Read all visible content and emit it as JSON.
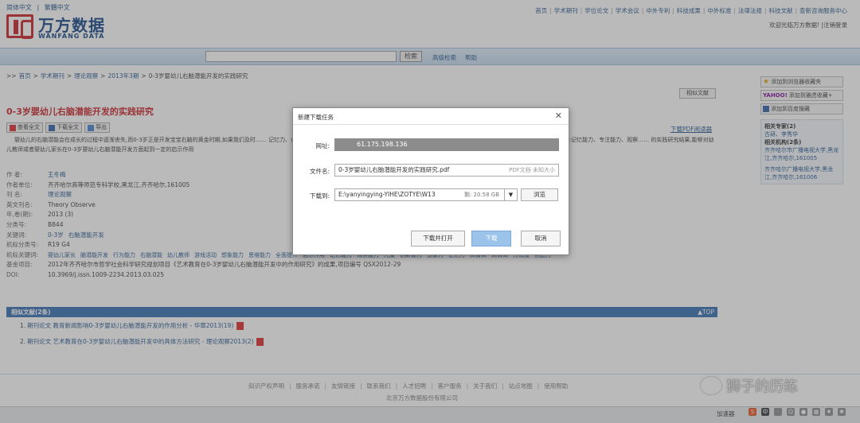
{
  "lang": {
    "simplified": "简体中文",
    "sep": "|",
    "traditional": "繁體中文"
  },
  "logo": {
    "cn": "万方数据",
    "en": "WANFANG DATA"
  },
  "topnav": [
    "首页",
    "学术期刊",
    "学位论文",
    "学术会议",
    "中外专利",
    "科技成果",
    "中外标准",
    "法律法规",
    "科技文献",
    "查新咨询服务中心"
  ],
  "welcome": "欢迎光临万方数据!  |注销登录",
  "search": {
    "button": "检索",
    "advanced": "高级检索",
    "help": "帮助"
  },
  "breadcrumb": {
    "prefix": ">>",
    "items": [
      "首页",
      "学术期刊",
      "理论观察",
      "2013年3期",
      "0-3岁婴幼儿右脑潜能开发的实践研究"
    ],
    "sep": ">"
  },
  "similar": "相似文献",
  "title": "0-3岁婴幼儿右脑潜能开发的实践研究",
  "toolbar": {
    "view": "查看全文",
    "download": "下载全文",
    "export": "导出"
  },
  "pdf_reader": "下载PDF阅读器",
  "abstract": "婴幼儿的右脑潜能会在成长的过程中逐渐丧失,而0-3岁正是开发宝宝右脑的黄金时期,如果我们及时…… 记忆力、创造力和想象力,最大限度地开发儿童右脑潜能,培养具备高智商、高情商的优秀儿童.全面提升孩子右脑的九大能力:记忆能力、专注能力、观察…… 的实践研究结果,能够对幼儿教师或者婴幼儿家长在0-3岁婴幼儿右脑潜能开发方面起到一定的启示作用",
  "meta": [
    {
      "k": "作  者:",
      "v": [
        "王冬梅"
      ],
      "link": true
    },
    {
      "k": "作者单位:",
      "v": [
        "齐齐哈尔高等师范专科学校,黑龙江,齐齐哈尔,161005"
      ],
      "link": false
    },
    {
      "k": "刊  名:",
      "v": [
        "理论观察"
      ],
      "link": true
    },
    {
      "k": "英文刊名:",
      "v": [
        "Theory Observe"
      ],
      "link": false
    },
    {
      "k": "年,卷(期):",
      "v": [
        "2013 (3)"
      ],
      "link": false
    },
    {
      "k": "分类号:",
      "v": [
        "B844"
      ],
      "link": false
    },
    {
      "k": "关键词:",
      "v": [
        "0-3岁",
        "右脑潜能开发"
      ],
      "link": true
    },
    {
      "k": "机标分类号:",
      "v": [
        "R19 G4"
      ],
      "link": false
    },
    {
      "k": "机标关键词:",
      "v": [
        "婴幼儿家长",
        "脑潜能开发",
        "行为能力",
        "右脑潜能",
        "幼儿教师",
        "游戏活动",
        "想象能力",
        "思维能力",
        "全面提升",
        "启示作用",
        "记忆能力",
        "观察能力",
        "儿童",
        "创新能力",
        "想象力",
        "记忆力",
        "高智商",
        "高情商",
        "方法及",
        "创造力"
      ],
      "link": true
    },
    {
      "k": "基金项目:",
      "v": [
        "2012年齐齐哈尔市哲学社会科学研究规划项目《艺术教育在0-3岁婴幼儿右脑潜能开发中的作用研究》的成果,项目编号 QSX2012-29"
      ],
      "link": false
    },
    {
      "k": "DOI:",
      "v": [
        "10.3969/j.issn.1009-2234.2013.03.025"
      ],
      "link": false
    }
  ],
  "related": {
    "header": "相似文献(2条)",
    "top": "▲TOP",
    "items": [
      {
        "num": "1.",
        "text": "期刊论文 教育新闻影响0-3岁婴幼儿右脑潜能开发的作用分析 - 华章2013(19)"
      },
      {
        "num": "2.",
        "text": "期刊论文 艺术教育在0-3岁婴幼儿右脑潜能开发中的具体方法研究 - 理论观察2013(2)"
      }
    ]
  },
  "sidebar": {
    "favorites": "添加到浏览器收藏夹",
    "yahoo_logo": "YAHOO!",
    "yahoo": "添加到雅虎收藏+",
    "baidu": "添加到百度搜藏",
    "experts_title": "相关专家(2)",
    "experts_names": "古研、李秀华",
    "orgs_title": "相关机构(2条)",
    "orgs": [
      "齐齐哈尔市广播电视大学,黑龙江,齐齐哈尔,161005",
      "齐齐哈尔广播电视大学,黑龙江,齐齐哈尔,161006"
    ]
  },
  "footer": {
    "links": [
      "知识产权声明",
      "服务承诺",
      "友情链接",
      "联系我们",
      "人才招聘",
      "客户服务",
      "关于我们",
      "站点地图",
      "使用帮助"
    ],
    "copyright": "北京万方数据股份有限公司"
  },
  "watermark": "狮子的历练",
  "statusbar": {
    "speed": "加速器"
  },
  "dialog": {
    "title": "新建下载任务",
    "close": "✕",
    "url_label": "网址:",
    "url": "61.175.198.136",
    "filename_label": "文件名:",
    "filename": "0-3岁婴幼儿右脑潜能开发的实践研究.pdf",
    "filetype": "PDF文档  未知大小",
    "dir_label": "下载到:",
    "dir": "E:\\yanyingying-YIHE\\ZOTYE\\W13",
    "free": "剩: 20.58 GB",
    "browse": "浏览",
    "open_btn": "下载并打开",
    "download_btn": "下载",
    "cancel_btn": "取消"
  }
}
